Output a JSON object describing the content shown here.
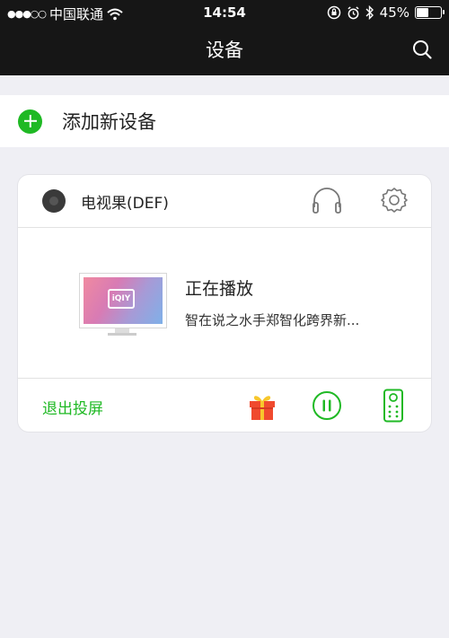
{
  "status_bar": {
    "signal": "●●●○○",
    "carrier": "中国联通",
    "time": "14:54",
    "battery_percent": "45%",
    "battery_level": 0.45
  },
  "nav": {
    "title": "设备"
  },
  "add_device": {
    "label": "添加新设备"
  },
  "device_card": {
    "device_name": "电视果(DEF)",
    "now_playing_title": "正在播放",
    "now_playing_subtitle": "智在说之水手郑智化跨界新...",
    "tv_logo": "iQIY",
    "exit_label": "退出投屏"
  },
  "colors": {
    "accent": "#1fb924",
    "nav_bg": "#161616",
    "page_bg": "#efeff4",
    "gift": "#f04a2e"
  },
  "icons": {
    "search": "search-icon",
    "add": "plus-circle-icon",
    "headphones": "headphones-icon",
    "settings": "gear-icon",
    "gift": "gift-icon",
    "pause": "pause-icon",
    "remote": "remote-control-icon"
  }
}
